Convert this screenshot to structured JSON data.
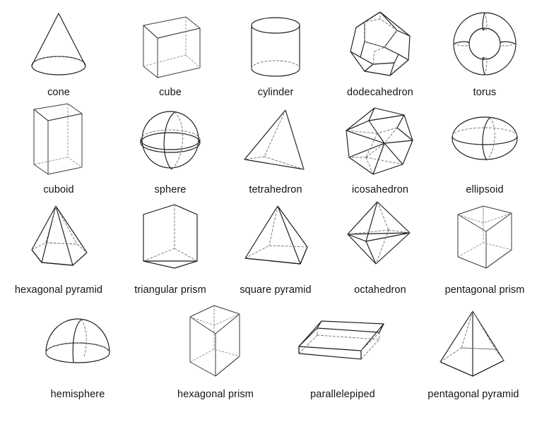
{
  "page": {
    "title": "3D geometric shapes chart",
    "background_color": "#ffffff",
    "stroke_color": "#1a1a1a",
    "hidden_edge_color": "#6e6e6e",
    "label_color": "#141414",
    "columns": 5,
    "rows": 4,
    "shape_count": 19
  },
  "rows": [
    {
      "index": 1,
      "shapes": [
        {
          "name": "cone",
          "label": "cone",
          "kind": "solid-of-revolution",
          "faces": "1 curved + 1 circular base"
        },
        {
          "name": "cube",
          "label": "cube",
          "kind": "polyhedron",
          "faces": "6 square faces"
        },
        {
          "name": "cylinder",
          "label": "cylinder",
          "kind": "solid-of-revolution",
          "faces": "1 curved + 2 circular bases"
        },
        {
          "name": "dodecahedron",
          "label": "dodecahedron",
          "kind": "platonic-solid",
          "faces": "12 pentagonal faces"
        },
        {
          "name": "torus",
          "label": "torus",
          "kind": "solid-of-revolution",
          "faces": "1 curved ring surface"
        }
      ]
    },
    {
      "index": 2,
      "shapes": [
        {
          "name": "cuboid",
          "label": "cuboid",
          "kind": "polyhedron",
          "faces": "6 rectangular faces"
        },
        {
          "name": "sphere",
          "label": "sphere",
          "kind": "solid-of-revolution",
          "faces": "1 curved surface"
        },
        {
          "name": "tetrahedron",
          "label": "tetrahedron",
          "kind": "platonic-solid",
          "faces": "4 triangular faces"
        },
        {
          "name": "icosahedron",
          "label": "icosahedron",
          "kind": "platonic-solid",
          "faces": "20 triangular faces"
        },
        {
          "name": "ellipsoid",
          "label": "ellipsoid",
          "kind": "solid-of-revolution",
          "faces": "1 curved surface"
        }
      ]
    },
    {
      "index": 3,
      "shapes": [
        {
          "name": "hexagonal-pyramid",
          "label": "hexagonal pyramid",
          "kind": "pyramid",
          "faces": "6 triangular + 1 hexagonal base"
        },
        {
          "name": "triangular-prism",
          "label": "triangular prism",
          "kind": "prism",
          "faces": "3 rectangular + 2 triangular bases"
        },
        {
          "name": "square-pyramid",
          "label": "square pyramid",
          "kind": "pyramid",
          "faces": "4 triangular + 1 square base"
        },
        {
          "name": "octahedron",
          "label": "octahedron",
          "kind": "platonic-solid",
          "faces": "8 triangular faces"
        },
        {
          "name": "pentagonal-prism",
          "label": "pentagonal prism",
          "kind": "prism",
          "faces": "5 rectangular + 2 pentagonal bases"
        }
      ]
    },
    {
      "index": 4,
      "shapes": [
        {
          "name": "hemisphere",
          "label": "hemisphere",
          "kind": "solid-of-revolution",
          "faces": "1 curved + 1 circular base"
        },
        {
          "name": "hexagonal-prism",
          "label": "hexagonal prism",
          "kind": "prism",
          "faces": "6 rectangular + 2 hexagonal bases"
        },
        {
          "name": "parallelepiped",
          "label": "parallelepiped",
          "kind": "polyhedron",
          "faces": "6 parallelogram faces"
        },
        {
          "name": "pentagonal-pyramid",
          "label": "pentagonal pyramid",
          "kind": "pyramid",
          "faces": "5 triangular + 1 pentagonal base"
        }
      ]
    }
  ]
}
